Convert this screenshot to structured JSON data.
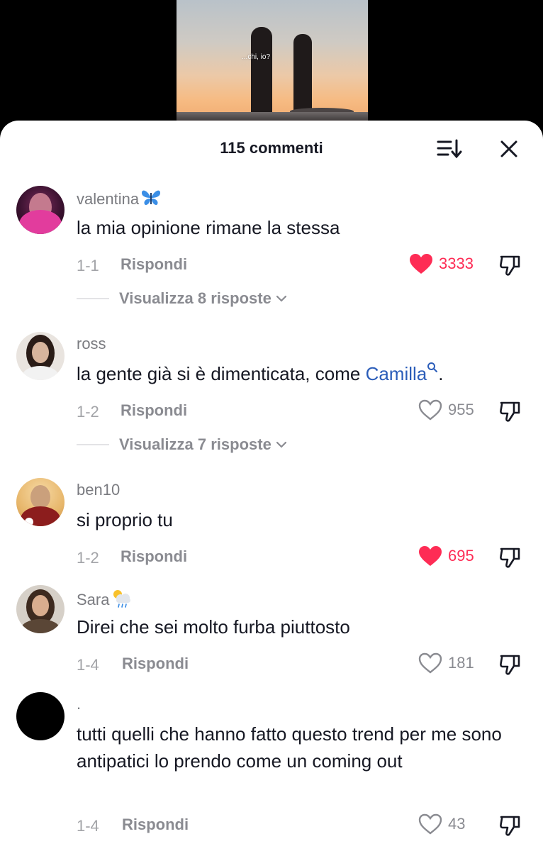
{
  "video": {
    "caption": "...chi, io?"
  },
  "header": {
    "title": "115 commenti"
  },
  "colors": {
    "like_active": "#fe2c55",
    "mention": "#2b5db9",
    "muted": "#8a8b91"
  },
  "icons": {
    "sort": "sort-icon",
    "close": "close-icon",
    "heart": "heart-icon",
    "dislike": "dislike-icon",
    "chevron": "chevron-down-icon"
  },
  "comments": [
    {
      "user": "valentina",
      "user_emoji": "butterfly",
      "text": "la mia opinione rimane la stessa",
      "date": "1-1",
      "reply": "Rispondi",
      "likes": "3333",
      "liked": true,
      "replies": "Visualizza 8 risposte"
    },
    {
      "user": "ross",
      "text_before": "la gente già si è dimenticata, come ",
      "mention": "Camilla",
      "text_after": ".",
      "date": "1-2",
      "reply": "Rispondi",
      "likes": "955",
      "liked": false,
      "replies": "Visualizza 7 risposte"
    },
    {
      "user": "ben10",
      "text": "si proprio tu",
      "date": "1-2",
      "reply": "Rispondi",
      "likes": "695",
      "liked": true
    },
    {
      "user": "Sara",
      "user_emoji": "rain-cloud",
      "text": "Direi che sei molto furba piuttosto",
      "date": "1-4",
      "reply": "Rispondi",
      "likes": "181",
      "liked": false
    },
    {
      "user": ".",
      "text": "tutti quelli che hanno fatto questo trend per me sono antipatici lo prendo come un coming out",
      "date": "1-4",
      "reply": "Rispondi",
      "likes": "43",
      "liked": false
    }
  ]
}
